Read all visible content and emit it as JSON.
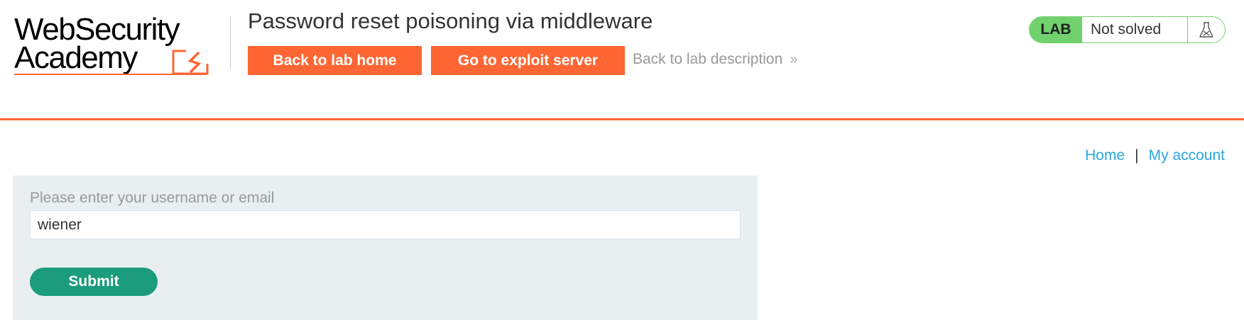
{
  "header": {
    "logo": {
      "line1": "WebSecurity",
      "line2": "Academy"
    },
    "lab_title": "Password reset poisoning via middleware",
    "buttons": {
      "lab_home": "Back to lab home",
      "exploit_server": "Go to exploit server"
    },
    "back_description": "Back to lab description",
    "back_description_icon": "double-chevron-right-icon",
    "lab_status": {
      "badge": "LAB",
      "state": "Not solved",
      "icon": "flask-icon"
    }
  },
  "nav": {
    "home": "Home",
    "separator": "|",
    "my_account": "My account"
  },
  "form": {
    "label": "Please enter your username or email",
    "username_value": "wiener",
    "submit_label": "Submit"
  },
  "colors": {
    "accent_orange": "#ff6633",
    "lab_green": "#70d16d",
    "submit_green": "#1a9c7d",
    "link_blue": "#29a8e0",
    "panel_bg": "#e9eef1"
  }
}
